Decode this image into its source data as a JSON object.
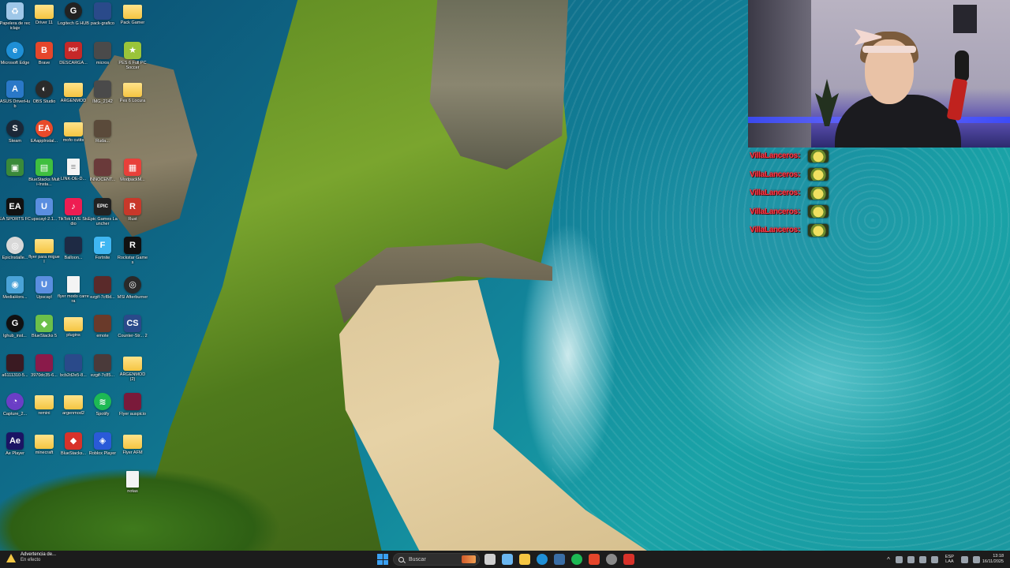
{
  "desktop": {
    "icons": [
      {
        "label": "Papelera de reciclaje",
        "color": "#9ec7e8",
        "kind": "app",
        "glyph": "♻"
      },
      {
        "label": "Microsoft Edge",
        "color": "#1f8fd6",
        "kind": "round",
        "glyph": "e"
      },
      {
        "label": "ASUS DriverHub",
        "color": "#2a78c8",
        "kind": "app",
        "glyph": "A"
      },
      {
        "label": "Steam",
        "color": "#1b2838",
        "kind": "round",
        "glyph": "S"
      },
      {
        "label": "",
        "color": "#3a8a3a",
        "kind": "app",
        "glyph": "▣"
      },
      {
        "label": "EA SPORTS FC",
        "color": "#111111",
        "kind": "app",
        "glyph": "EA"
      },
      {
        "label": "EpicInstalle...",
        "color": "#d8d8d8",
        "kind": "round",
        "glyph": "◎"
      },
      {
        "label": "MediaHors...",
        "color": "#4aa3d8",
        "kind": "app",
        "glyph": "◉"
      },
      {
        "label": "lghub_inst...",
        "color": "#111111",
        "kind": "round",
        "glyph": "G"
      },
      {
        "label": "a6111310-5...",
        "color": "#3a1a22",
        "kind": "app",
        "glyph": ""
      },
      {
        "label": "Capture_2...",
        "color": "#6b3ec6",
        "kind": "round",
        "glyph": "◔"
      },
      {
        "label": "Ae Player",
        "color": "#1b1464",
        "kind": "app",
        "glyph": "Ae"
      },
      {
        "label": "Driver 11",
        "color": "",
        "kind": "folder",
        "glyph": ""
      },
      {
        "label": "Brave",
        "color": "#e5462b",
        "kind": "app",
        "glyph": "B"
      },
      {
        "label": "OBS Studio",
        "color": "#2b2b2b",
        "kind": "round",
        "glyph": "◐"
      },
      {
        "label": "EAappInstal...",
        "color": "#e84a2a",
        "kind": "round",
        "glyph": "EA"
      },
      {
        "label": "BlueStacks Multi-Insta...",
        "color": "#3fbf3f",
        "kind": "app",
        "glyph": "▤"
      },
      {
        "label": "upscayl-2.1...",
        "color": "#5a8ee0",
        "kind": "app",
        "glyph": "U"
      },
      {
        "label": "flyer para miguel",
        "color": "",
        "kind": "folder",
        "glyph": ""
      },
      {
        "label": "Upscayl",
        "color": "#5a8ee0",
        "kind": "app",
        "glyph": "U"
      },
      {
        "label": "BlueStacks 5",
        "color": "#6cc04a",
        "kind": "app",
        "glyph": "◆"
      },
      {
        "label": "3970dc35-6...",
        "color": "#8a1a4a",
        "kind": "app",
        "glyph": ""
      },
      {
        "label": "remini",
        "color": "",
        "kind": "folder",
        "glyph": ""
      },
      {
        "label": "minecraft",
        "color": "",
        "kind": "folder",
        "glyph": ""
      },
      {
        "label": "Logitech G HUB",
        "color": "#222222",
        "kind": "round",
        "glyph": "G"
      },
      {
        "label": "DESCARGA...",
        "color": "#c62828",
        "kind": "app",
        "glyph": "PDF"
      },
      {
        "label": "ARGENMOD",
        "color": "",
        "kind": "folder",
        "glyph": ""
      },
      {
        "label": "mofo cutits",
        "color": "",
        "kind": "folder",
        "glyph": ""
      },
      {
        "label": "LINK-DE-D...",
        "color": "#f4f4f4",
        "kind": "doc",
        "glyph": "≡"
      },
      {
        "label": "TikTok LIVE Studio",
        "color": "#ee1d52",
        "kind": "app",
        "glyph": "♪"
      },
      {
        "label": "Balloon...",
        "color": "#1e2a44",
        "kind": "app",
        "glyph": ""
      },
      {
        "label": "flyer modo carrera",
        "color": "#f4f4f4",
        "kind": "doc",
        "glyph": ""
      },
      {
        "label": "plugins",
        "color": "",
        "kind": "folder",
        "glyph": ""
      },
      {
        "label": "bcb2d2e5-8...",
        "color": "#2a4a8a",
        "kind": "app",
        "glyph": ""
      },
      {
        "label": "argenmod2",
        "color": "",
        "kind": "folder",
        "glyph": ""
      },
      {
        "label": "BlueStacks...",
        "color": "#d8322a",
        "kind": "app",
        "glyph": "◆"
      },
      {
        "label": "pack-grafico",
        "color": "#2a4a8a",
        "kind": "app",
        "glyph": ""
      },
      {
        "label": "micros",
        "color": "#4a4a4a",
        "kind": "app",
        "glyph": ""
      },
      {
        "label": "IMG_2142",
        "color": "#4a4a4a",
        "kind": "app",
        "glyph": ""
      },
      {
        "label": "Ruda...",
        "color": "#5a4a3a",
        "kind": "app",
        "glyph": ""
      },
      {
        "label": "INNOCENT...",
        "color": "#6a3a3a",
        "kind": "app",
        "glyph": ""
      },
      {
        "label": "Epic Games Launcher",
        "color": "#222222",
        "kind": "app",
        "glyph": "EPIC"
      },
      {
        "label": "Fortnite",
        "color": "#3fb6f2",
        "kind": "app",
        "glyph": "F"
      },
      {
        "label": "ezgif-7cf8d...",
        "color": "#5a2a2a",
        "kind": "app",
        "glyph": ""
      },
      {
        "label": "emote",
        "color": "#6a3a2a",
        "kind": "app",
        "glyph": ""
      },
      {
        "label": "ezgif-7c85...",
        "color": "#4a3a3a",
        "kind": "app",
        "glyph": ""
      },
      {
        "label": "Spotify",
        "color": "#1db954",
        "kind": "round",
        "glyph": "≋"
      },
      {
        "label": "Roblox Player",
        "color": "#2a5ad8",
        "kind": "app",
        "glyph": "◈"
      },
      {
        "label": "Pack Gamer",
        "color": "",
        "kind": "folder",
        "glyph": ""
      },
      {
        "label": "PES 6 Full PC Soccer",
        "color": "#9ac43a",
        "kind": "app",
        "glyph": "★"
      },
      {
        "label": "Pes 6 Locura",
        "color": "",
        "kind": "folder",
        "glyph": ""
      },
      {
        "label": "",
        "color": "",
        "kind": "none",
        "glyph": ""
      },
      {
        "label": "ModpackM...",
        "color": "#e8403a",
        "kind": "app",
        "glyph": "▦"
      },
      {
        "label": "Rust",
        "color": "#c8382a",
        "kind": "app",
        "glyph": "R"
      },
      {
        "label": "Rockstar Games",
        "color": "#111111",
        "kind": "app",
        "glyph": "R"
      },
      {
        "label": "MSI Afterburner",
        "color": "#2a2a2a",
        "kind": "round",
        "glyph": "◎"
      },
      {
        "label": "Counter-Str... 2",
        "color": "#2a4a8a",
        "kind": "app",
        "glyph": "CS"
      },
      {
        "label": "ARGENMOD (2)",
        "color": "",
        "kind": "folder",
        "glyph": ""
      },
      {
        "label": "Flyer auspicio",
        "color": "#7a1a3a",
        "kind": "app",
        "glyph": ""
      },
      {
        "label": "Flyer AFM",
        "color": "",
        "kind": "folder",
        "glyph": ""
      },
      {
        "label": "notas",
        "color": "#f4f4f4",
        "kind": "doc",
        "glyph": ""
      }
    ]
  },
  "webcam": {},
  "alerts": [
    {
      "name": "VillaLanceros:"
    },
    {
      "name": "VillaLanceros:"
    },
    {
      "name": "VillaLanceros:"
    },
    {
      "name": "VillaLanceros:"
    },
    {
      "name": "VillaLanceros:"
    }
  ],
  "taskbar": {
    "notification": {
      "title": "Advertencia de...",
      "subtitle": "En efecto"
    },
    "search_placeholder": "Buscar",
    "apps": [
      {
        "name": "task-view",
        "color": "#cfcfcf"
      },
      {
        "name": "copilot",
        "color": "#6ab6f0"
      },
      {
        "name": "file-explorer",
        "color": "#f5c542"
      },
      {
        "name": "edge",
        "color": "#1f8fd6"
      },
      {
        "name": "steam",
        "color": "#3a6ea5"
      },
      {
        "name": "spotify",
        "color": "#1db954"
      },
      {
        "name": "brave",
        "color": "#e5462b"
      },
      {
        "name": "obs",
        "color": "#8a8a8a"
      },
      {
        "name": "capture",
        "color": "#d8322a"
      }
    ],
    "language": {
      "code": "ESP",
      "layout": "LAA"
    },
    "time": "13:18",
    "date": "16/11/2025"
  }
}
